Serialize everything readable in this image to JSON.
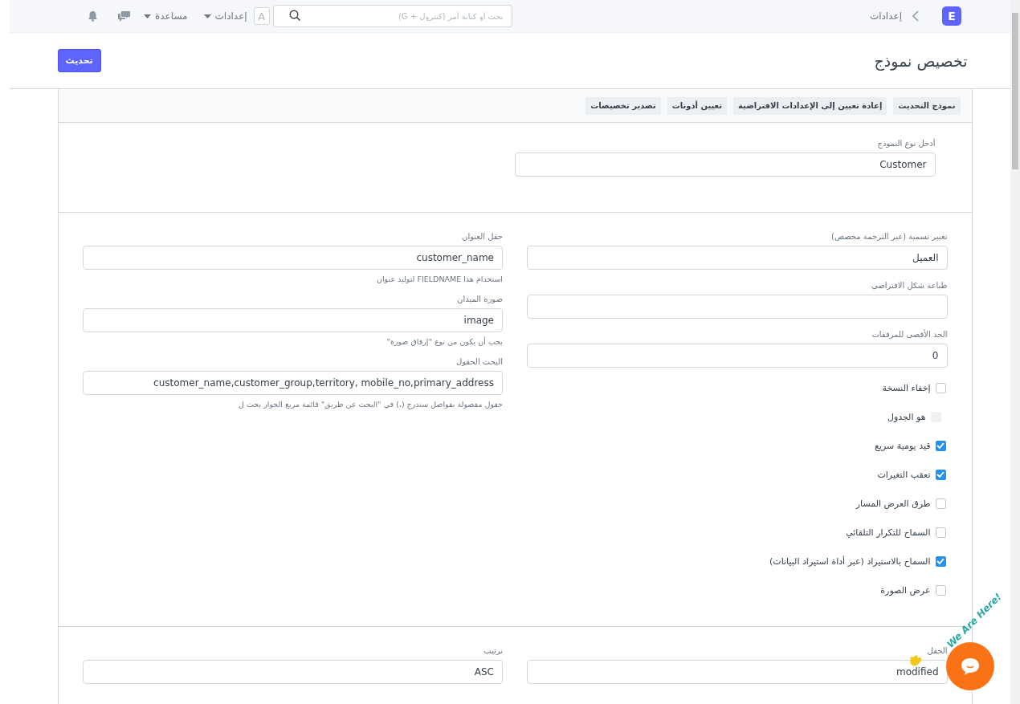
{
  "navbar": {
    "logo": "E",
    "breadcrumb": "إعدادات",
    "search": {
      "placeholder": "بحث أو كتابة أمر (كنترول + G)"
    },
    "avatar": "A",
    "menus": [
      {
        "label": "إعدادات"
      },
      {
        "label": "مساعدة"
      }
    ]
  },
  "page": {
    "title": "تخصيص نموذج",
    "primary_button": "تحديث"
  },
  "toolbar": {
    "buttons": [
      "نموذج التحديث",
      "إعادة تعيين إلى الإعدادات الافتراضية",
      "تعيين أذونات",
      "تصدير تخصيصات"
    ]
  },
  "doctype_field": {
    "label": "أدخل نوع النموذج",
    "value": "Customer"
  },
  "sections": [
    {
      "columns": [
        [
          {
            "kind": "input",
            "label": "تغيير تسمية (عبر الترجمة مخصص)",
            "value": "العميل"
          },
          {
            "kind": "input",
            "label": "طباعة شكل الافتراضي"
          },
          {
            "kind": "input",
            "label": "الحد الأقصى للمرفقات",
            "value": "0"
          },
          {
            "kind": "check",
            "label": "إخفاء النسخة",
            "checked": false,
            "disabled": false
          },
          {
            "kind": "check",
            "label": "هو الجدول",
            "checked": false,
            "disabled": true
          },
          {
            "kind": "check",
            "label": "قيد يومية سريع",
            "checked": true,
            "disabled": false
          },
          {
            "kind": "check",
            "label": "تعقب التغيرات",
            "checked": true,
            "disabled": false
          },
          {
            "kind": "check",
            "label": "طرق العرض المسار",
            "checked": false,
            "disabled": false
          },
          {
            "kind": "check",
            "label": "السماح للتكرار التلقائي",
            "checked": false,
            "disabled": false
          },
          {
            "kind": "check",
            "label": "السماح بالاستيراد (عبر أداة استيراد البيانات)",
            "checked": true,
            "disabled": false
          },
          {
            "kind": "check",
            "label": "عرض الصورة",
            "checked": false,
            "disabled": false
          }
        ],
        [
          {
            "kind": "input",
            "label": "حقل العنوان",
            "value": "customer_name",
            "description": "استخدام هذا FIELDNAME لتوليد عنوان"
          },
          {
            "kind": "input",
            "label": "صورة الميدان",
            "value": "image",
            "description": "يجب أن يكون من نوع \"إرفاق صورة\""
          },
          {
            "kind": "input",
            "label": "البحث الحقول",
            "value": "customer_name,customer_group,territory, mobile_no,primary_address",
            "description": "حقول مفصولة بفواصل ستدرج (،) في \"البحث عن طريق\" قائمة مربع الحوار بحث ل"
          }
        ]
      ]
    },
    {
      "columns": [
        [
          {
            "kind": "input",
            "label": "الحقل",
            "value": "modified"
          }
        ],
        [
          {
            "kind": "input",
            "label": "ترتيب",
            "value": "ASC"
          }
        ]
      ]
    }
  ],
  "chat_widget": {
    "tagline": "We Are Here!"
  }
}
